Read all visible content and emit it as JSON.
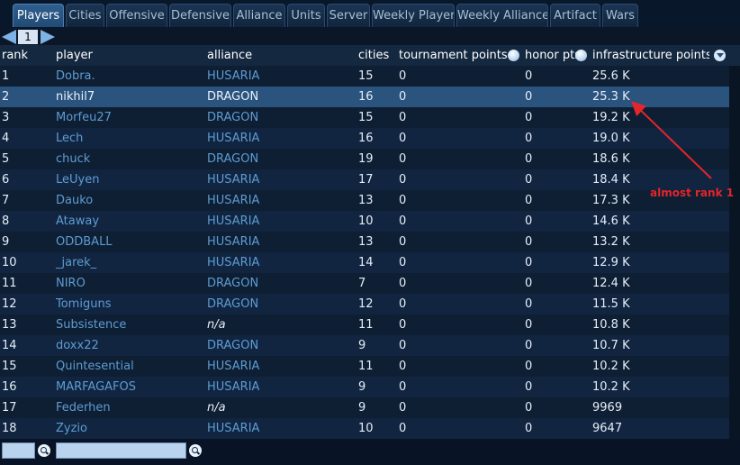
{
  "tabs": [
    {
      "label": "Players",
      "active": true
    },
    {
      "label": "Cities"
    },
    {
      "label": "Offensive"
    },
    {
      "label": "Defensive"
    },
    {
      "label": "Alliance"
    },
    {
      "label": "Units"
    },
    {
      "label": "Server"
    },
    {
      "label": "Weekly Player"
    },
    {
      "label": "Weekly Alliance"
    },
    {
      "label": "Artifact"
    },
    {
      "label": "Wars"
    }
  ],
  "pager": {
    "page": "1"
  },
  "columns": {
    "rank": "rank",
    "player": "player",
    "alliance": "alliance",
    "cities": "cities",
    "tournament": "tournament points",
    "honor": "honor pts",
    "infrastructure": "infrastructure points"
  },
  "rows": [
    {
      "rank": "1",
      "player": "Dobra.",
      "alliance": "HUSARIA",
      "cities": "15",
      "tournament": "0",
      "honor": "0",
      "infrastructure": "25.6 K"
    },
    {
      "rank": "2",
      "player": "nikhil7",
      "alliance": "DRAGON",
      "cities": "16",
      "tournament": "0",
      "honor": "0",
      "infrastructure": "25.3 K",
      "selected": true
    },
    {
      "rank": "3",
      "player": "Morfeu27",
      "alliance": "DRAGON",
      "cities": "15",
      "tournament": "0",
      "honor": "0",
      "infrastructure": "19.2 K"
    },
    {
      "rank": "4",
      "player": "Lech",
      "alliance": "HUSARIA",
      "cities": "16",
      "tournament": "0",
      "honor": "0",
      "infrastructure": "19.0 K"
    },
    {
      "rank": "5",
      "player": "chuck",
      "alliance": "DRAGON",
      "cities": "19",
      "tournament": "0",
      "honor": "0",
      "infrastructure": "18.6 K"
    },
    {
      "rank": "6",
      "player": "LeUyen",
      "alliance": "HUSARIA",
      "cities": "17",
      "tournament": "0",
      "honor": "0",
      "infrastructure": "18.4 K"
    },
    {
      "rank": "7",
      "player": "Dauko",
      "alliance": "HUSARIA",
      "cities": "13",
      "tournament": "0",
      "honor": "0",
      "infrastructure": "17.3 K"
    },
    {
      "rank": "8",
      "player": "Ataway",
      "alliance": "HUSARIA",
      "cities": "10",
      "tournament": "0",
      "honor": "0",
      "infrastructure": "14.6 K"
    },
    {
      "rank": "9",
      "player": "ODDBALL",
      "alliance": "HUSARIA",
      "cities": "13",
      "tournament": "0",
      "honor": "0",
      "infrastructure": "13.2 K"
    },
    {
      "rank": "10",
      "player": "_jarek_",
      "alliance": "HUSARIA",
      "cities": "14",
      "tournament": "0",
      "honor": "0",
      "infrastructure": "12.9 K"
    },
    {
      "rank": "11",
      "player": "NIRO",
      "alliance": "DRAGON",
      "cities": "7",
      "tournament": "0",
      "honor": "0",
      "infrastructure": "12.4 K"
    },
    {
      "rank": "12",
      "player": "Tomiguns",
      "alliance": "DRAGON",
      "cities": "12",
      "tournament": "0",
      "honor": "0",
      "infrastructure": "11.5 K"
    },
    {
      "rank": "13",
      "player": "Subsistence",
      "alliance": "n/a",
      "cities": "11",
      "tournament": "0",
      "honor": "0",
      "infrastructure": "10.8 K"
    },
    {
      "rank": "14",
      "player": "doxx22",
      "alliance": "DRAGON",
      "cities": "9",
      "tournament": "0",
      "honor": "0",
      "infrastructure": "10.7 K"
    },
    {
      "rank": "15",
      "player": "Quintesential",
      "alliance": "HUSARIA",
      "cities": "11",
      "tournament": "0",
      "honor": "0",
      "infrastructure": "10.2 K"
    },
    {
      "rank": "16",
      "player": "MARFAGAFOS",
      "alliance": "HUSARIA",
      "cities": "9",
      "tournament": "0",
      "honor": "0",
      "infrastructure": "10.2 K"
    },
    {
      "rank": "17",
      "player": "Federhen",
      "alliance": "n/a",
      "cities": "9",
      "tournament": "0",
      "honor": "0",
      "infrastructure": "9969"
    },
    {
      "rank": "18",
      "player": "Zyzio",
      "alliance": "HUSARIA",
      "cities": "10",
      "tournament": "0",
      "honor": "0",
      "infrastructure": "9647"
    }
  ],
  "footer": {
    "search1_value": "",
    "search2_value": ""
  },
  "annotation": {
    "text": "almost rank 1",
    "color": "#e1262c"
  }
}
